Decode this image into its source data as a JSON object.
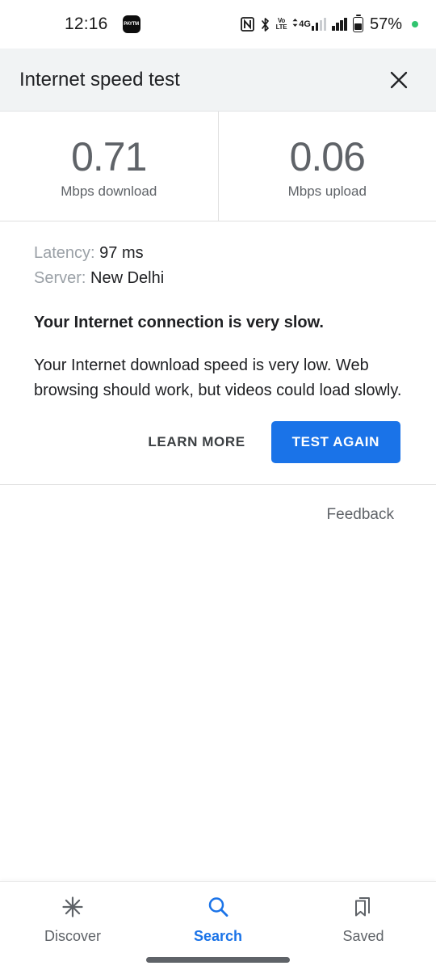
{
  "status_bar": {
    "clock": "12:16",
    "notification_icons": [
      {
        "name": "paytm-app-icon",
        "label": "Paytm"
      }
    ],
    "system_icons": [
      "nfc-icon",
      "bluetooth-icon",
      "volte-icon",
      "4g-signal-icon",
      "signal-bars-icon",
      "battery-icon"
    ],
    "volte_top": "Vo",
    "volte_bottom": "LTE",
    "network_type": "4G",
    "battery_percent": "57%",
    "battery_level_fraction": 0.57,
    "recording_dot_color": "#31c46f"
  },
  "header": {
    "title": "Internet speed test",
    "close_label": "Close",
    "background": "#f1f3f4"
  },
  "results": [
    {
      "value": "0.71",
      "label": "Mbps download",
      "name": "download-result"
    },
    {
      "value": "0.06",
      "label": "Mbps upload",
      "name": "upload-result"
    }
  ],
  "details": {
    "latency_label": "Latency:",
    "latency_value": "97 ms",
    "server_label": "Server:",
    "server_value": "New Delhi",
    "verdict": "Your Internet connection is very slow.",
    "description": "Your Internet download speed is very low. Web browsing should work, but videos could load slowly."
  },
  "actions": {
    "learn_more": "LEARN MORE",
    "test_again": "TEST AGAIN",
    "accent_color": "#1a73e8"
  },
  "feedback": {
    "label": "Feedback"
  },
  "bottom_nav": {
    "items": [
      {
        "label": "Discover",
        "icon": "discover-asterisk-icon",
        "active": false
      },
      {
        "label": "Search",
        "icon": "search-magnifier-icon",
        "active": true
      },
      {
        "label": "Saved",
        "icon": "saved-bookmark-icon",
        "active": false
      }
    ],
    "active_color": "#1a73e8",
    "inactive_color": "#5f6368"
  }
}
